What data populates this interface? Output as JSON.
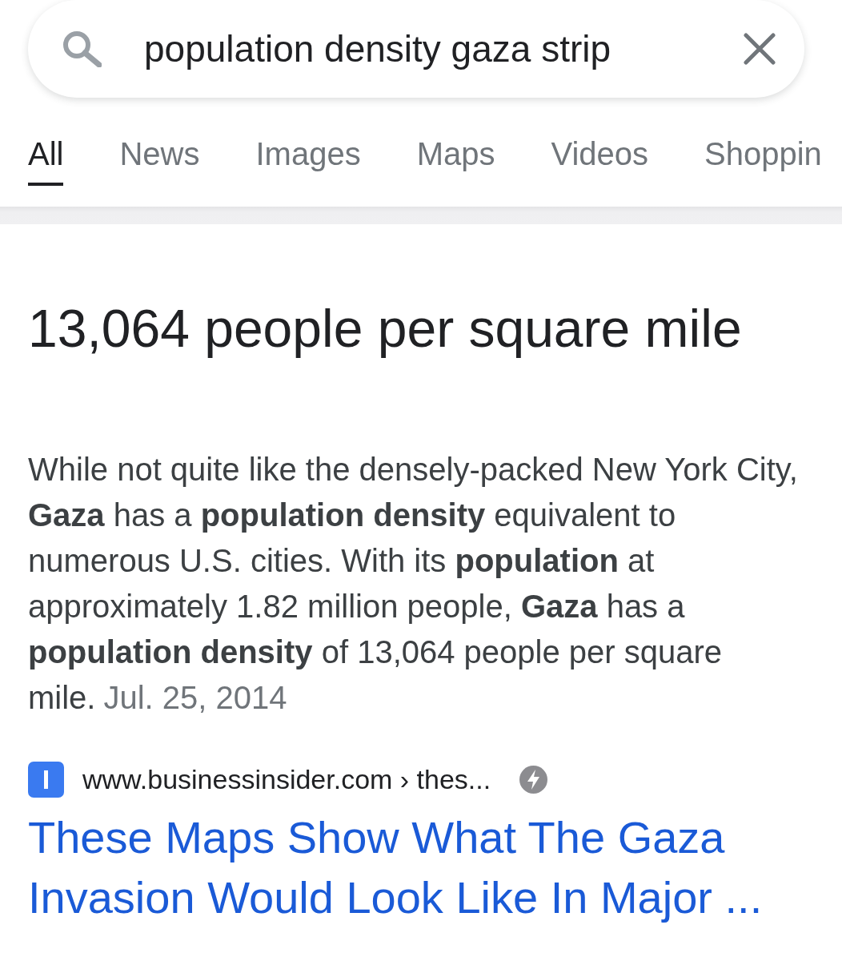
{
  "search": {
    "value": "population density gaza strip"
  },
  "tabs": [
    {
      "label": "All",
      "selected": true
    },
    {
      "label": "News",
      "selected": false
    },
    {
      "label": "Images",
      "selected": false
    },
    {
      "label": "Maps",
      "selected": false
    },
    {
      "label": "Videos",
      "selected": false
    },
    {
      "label": "Shoppin",
      "selected": false
    }
  ],
  "answer": {
    "heading": "13,064 people per square mile",
    "snippet": "While not quite like the densely-packed New York City, **Gaza** has a **population density** equivalent to numerous U.S. cities. With its **population** at approximately 1.82 million people, **Gaza** has a **population density** of 13,064 people per square mile.",
    "date": "Jul. 25, 2014"
  },
  "result": {
    "url": "www.businessinsider.com › thes...",
    "title": "These Maps Show What The Gaza Invasion Would Look Like In Major ..."
  }
}
